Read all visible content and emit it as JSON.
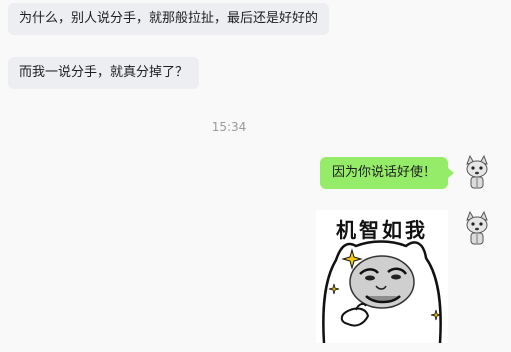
{
  "messages": {
    "m1": "为什么，别人说分手，就那般拉扯，最后还是好好的",
    "m2": "而我一说分手，就真分掉了？",
    "timestamp": "15:34",
    "m3": "因为你说话好使！",
    "sticker_text": "机智如我"
  },
  "colors": {
    "incoming_bubble": "#eceef2",
    "outgoing_bubble": "#95ec69",
    "background": "#f9f9f9",
    "timestamp": "#9b9b9b"
  },
  "icons": {
    "avatar": "wolf-avatar-icon",
    "sparkle": "sparkle-icon"
  }
}
